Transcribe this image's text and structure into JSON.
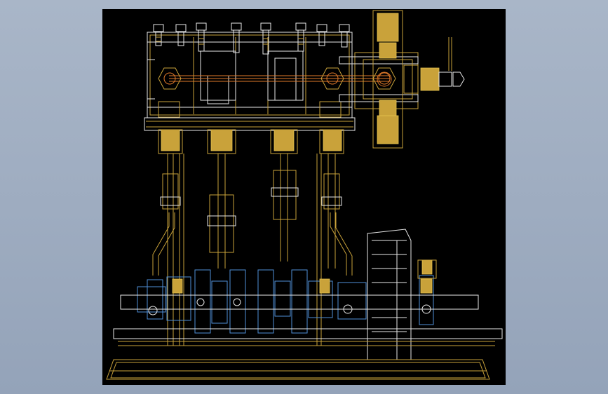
{
  "view": {
    "background_color": "#000000",
    "outer_background_color": "#a3b1c5"
  },
  "drawing": {
    "line_colors": {
      "frame": "#e8e8e8",
      "components": "#c9a23a",
      "crankshaft": "#4f8fd8",
      "linkage": "#e07a2a"
    },
    "cylinder_count": 4
  }
}
